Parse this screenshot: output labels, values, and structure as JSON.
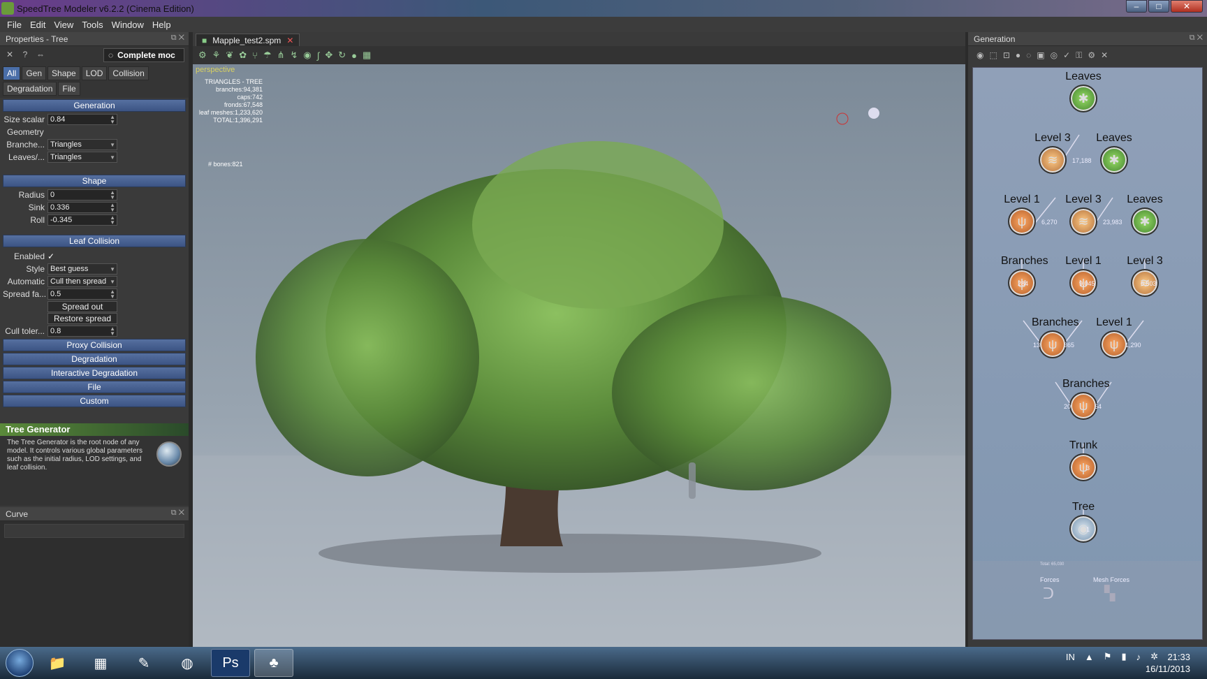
{
  "window": {
    "title": "SpeedTree Modeler v6.2.2 (Cinema Edition)"
  },
  "menu": [
    "File",
    "Edit",
    "View",
    "Tools",
    "Window",
    "Help"
  ],
  "properties": {
    "title": "Properties - Tree",
    "complete_label": "Complete moc",
    "tabs": [
      "All",
      "Gen",
      "Shape",
      "LOD",
      "Collision",
      "Degradation",
      "File"
    ],
    "sections": {
      "generation": "Generation",
      "shape": "Shape",
      "leaf_collision": "Leaf Collision"
    },
    "size_scalar": {
      "label": "Size scalar",
      "value": "0.84"
    },
    "geometry_label": "Geometry",
    "branches": {
      "label": "Branche...",
      "value": "Triangles"
    },
    "leaves": {
      "label": "Leaves/...",
      "value": "Triangles"
    },
    "radius": {
      "label": "Radius",
      "value": "0"
    },
    "sink": {
      "label": "Sink",
      "value": "0.336"
    },
    "roll": {
      "label": "Roll",
      "value": "-0.345"
    },
    "enabled": {
      "label": "Enabled",
      "value": "✓"
    },
    "style": {
      "label": "Style",
      "value": "Best guess"
    },
    "automatic": {
      "label": "Automatic",
      "value": "Cull then spread"
    },
    "spread": {
      "label": "Spread fa...",
      "value": "0.5"
    },
    "spread_out": "Spread out",
    "restore_spread": "Restore spread",
    "cull": {
      "label": "Cull toler...",
      "value": "0.8"
    },
    "more_sections": [
      "Proxy Collision",
      "Degradation",
      "Interactive Degradation",
      "File",
      "Custom"
    ]
  },
  "description": {
    "title": "Tree Generator",
    "text": "The Tree Generator is the root node of any model. It controls various global parameters such as the initial radius, LOD settings, and leaf collision."
  },
  "curve": {
    "title": "Curve"
  },
  "viewport": {
    "tab": "Mapple_test2.spm",
    "view_label": "perspective",
    "stats": [
      "TRIANGLES - TREE",
      "branches:94,381",
      "caps:742",
      "fronds:67,548",
      "leaf meshes:1,233,620",
      "TOTAL:1,396,291"
    ],
    "bones": "# bones:821"
  },
  "generation": {
    "title": "Generation",
    "nodes": [
      {
        "label": "Leaves",
        "kind": "leaf"
      },
      {
        "label": "Level 3",
        "kind": "frond"
      },
      {
        "label": "Leaves",
        "kind": "leaf"
      },
      {
        "label": "Level 1",
        "kind": "branch"
      },
      {
        "label": "Level 3",
        "kind": "frond"
      },
      {
        "label": "Leaves",
        "kind": "leaf"
      },
      {
        "label": "Branches",
        "kind": "branch"
      },
      {
        "label": "Level 1",
        "kind": "branch"
      },
      {
        "label": "Level 3",
        "kind": "frond"
      },
      {
        "label": "Branches",
        "kind": "branch"
      },
      {
        "label": "Level 1",
        "kind": "branch"
      },
      {
        "label": "Branches",
        "kind": "branch"
      },
      {
        "label": "Trunk",
        "kind": "branch"
      },
      {
        "label": "Tree",
        "kind": "tree"
      }
    ],
    "counts": [
      "17,188",
      "6,270",
      "23,983",
      "284",
      "9,045",
      "6,503",
      "13",
      "365",
      "1,290",
      "20",
      "64",
      "3",
      "1"
    ],
    "bottom": {
      "forces": "Forces",
      "mesh_forces": "Mesh Forces",
      "total": "Total: 65,030"
    }
  },
  "taskbar": {
    "lang": "IN",
    "time": "21:33",
    "date": "16/11/2013"
  }
}
